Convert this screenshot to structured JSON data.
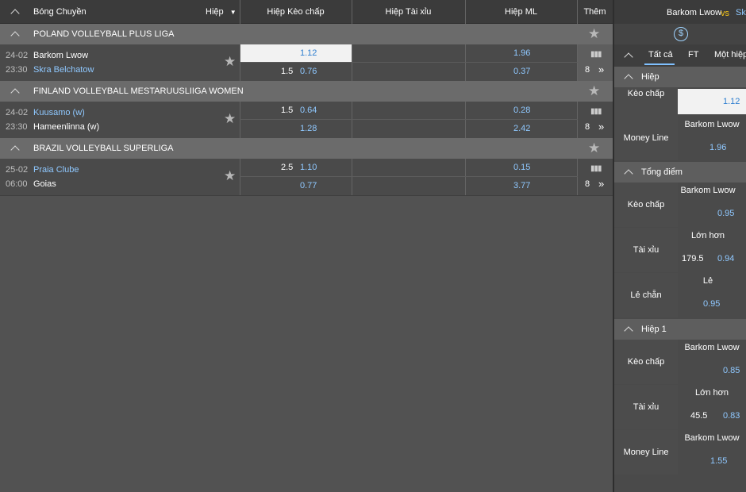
{
  "header": {
    "sport": "Bóng Chuyền",
    "period": "Hiệp",
    "col_handicap": "Hiệp Kèo chấp",
    "col_overunder": "Hiệp Tài xỉu",
    "col_ml": "Hiệp ML",
    "col_more": "Thêm"
  },
  "leagues": [
    {
      "name": "POLAND VOLLEYBALL PLUS LIGA"
    },
    {
      "name": "FINLAND VOLLEYBALL MESTARUUSLIIGA WOMEN"
    },
    {
      "name": "BRAZIL VOLLEYBALL SUPERLIGA"
    }
  ],
  "matches": [
    {
      "date": "24-02",
      "time": "23:30",
      "home": "Barkom Lwow",
      "away": "Skra Belchatow",
      "hcp_line": "1.5",
      "hcp_home": "1.12",
      "hcp_away": "0.76",
      "ml_home": "1.96",
      "ml_away": "0.37",
      "more": "8"
    },
    {
      "date": "24-02",
      "time": "23:30",
      "home": "Kuusamo (w)",
      "away": "Hameenlinna (w)",
      "hcp_line": "1.5",
      "hcp_home": "0.64",
      "hcp_away": "1.28",
      "ml_home": "0.28",
      "ml_away": "2.42",
      "more": "8"
    },
    {
      "date": "25-02",
      "time": "06:00",
      "home": "Praia Clube",
      "away": "Goias",
      "hcp_line": "2.5",
      "hcp_home": "1.10",
      "hcp_away": "0.77",
      "ml_home": "0.15",
      "ml_away": "3.77",
      "more": "8"
    }
  ],
  "panel": {
    "home": "Barkom Lwow",
    "vs": "vs",
    "away_partial": "Sk",
    "tabs": [
      "Tất cả",
      "FT",
      "Một hiệp"
    ],
    "sec1": "Hiệp",
    "sec1_hcp_label": "Kèo chấp",
    "sec1_hcp_odd": "1.12",
    "sec1_ml_label": "Money Line",
    "sec1_ml_team": "Barkom Lwow",
    "sec1_ml_odd": "1.96",
    "sec2": "Tổng điểm",
    "sec2_hcp_label": "Kèo chấp",
    "sec2_hcp_team": "Barkom Lwow",
    "sec2_hcp_odd": "0.95",
    "sec2_ou_label": "Tài xỉu",
    "sec2_ou_head": "Lớn hơn",
    "sec2_ou_line": "179.5",
    "sec2_ou_odd": "0.94",
    "sec2_oe_label": "Lẻ chẵn",
    "sec2_oe_head": "Lẻ",
    "sec2_oe_odd": "0.95",
    "sec3": "Hiệp 1",
    "sec3_hcp_label": "Kèo chấp",
    "sec3_hcp_team": "Barkom Lwow",
    "sec3_hcp_odd": "0.85",
    "sec3_ou_label": "Tài xỉu",
    "sec3_ou_head": "Lớn hơn",
    "sec3_ou_line": "45.5",
    "sec3_ou_odd": "0.83",
    "sec3_ml_label": "Money Line",
    "sec3_ml_team": "Barkom Lwow",
    "sec3_ml_odd": "1.55"
  },
  "icons": {
    "collapse": "chevron-up-icon",
    "star": "star-icon",
    "stats": "bar-chart-icon",
    "more": "double-chevron-right-icon",
    "cashout": "dollar-circle-icon",
    "sort": "caret-down-icon"
  },
  "colors": {
    "odds": "#8fc8ff",
    "highlight": "#f2f2f2",
    "header": "#3b3b3b",
    "league": "#6b6b6b",
    "vs": "#f5c518"
  }
}
